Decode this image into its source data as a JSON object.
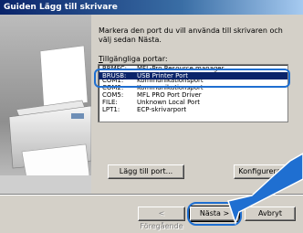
{
  "window": {
    "title": "Guiden Lägg till skrivare"
  },
  "content": {
    "instruction": "Markera den port du vill använda till skrivaren och välj sedan Nästa.",
    "ports_label_prefix": "T",
    "ports_label_rest": "illgängliga portar:"
  },
  "ports": [
    {
      "port": "BRMFC:",
      "description": "MFL-Pro Resource manager"
    },
    {
      "port": "BRUSB:",
      "description": "USB Printer Port",
      "selected": true
    },
    {
      "port": "COM1:",
      "description": "Kommunikationsport"
    },
    {
      "port": "COM2:",
      "description": "Kommunikationsport"
    },
    {
      "port": "COM5:",
      "description": "MFL PRO Port Driver"
    },
    {
      "port": "FILE:",
      "description": "Unknown Local Port"
    },
    {
      "port": "LPT1:",
      "description": "ECP-skrivarport"
    }
  ],
  "buttons": {
    "add_port": "Lägg till port...",
    "configure": "Konfigurera port",
    "back": "< Föregående",
    "next": "Nästa >",
    "cancel": "Avbryt"
  },
  "colors": {
    "title_start": "#0a246a",
    "selection": "#0a246a",
    "callout": "#1f6fd1"
  }
}
